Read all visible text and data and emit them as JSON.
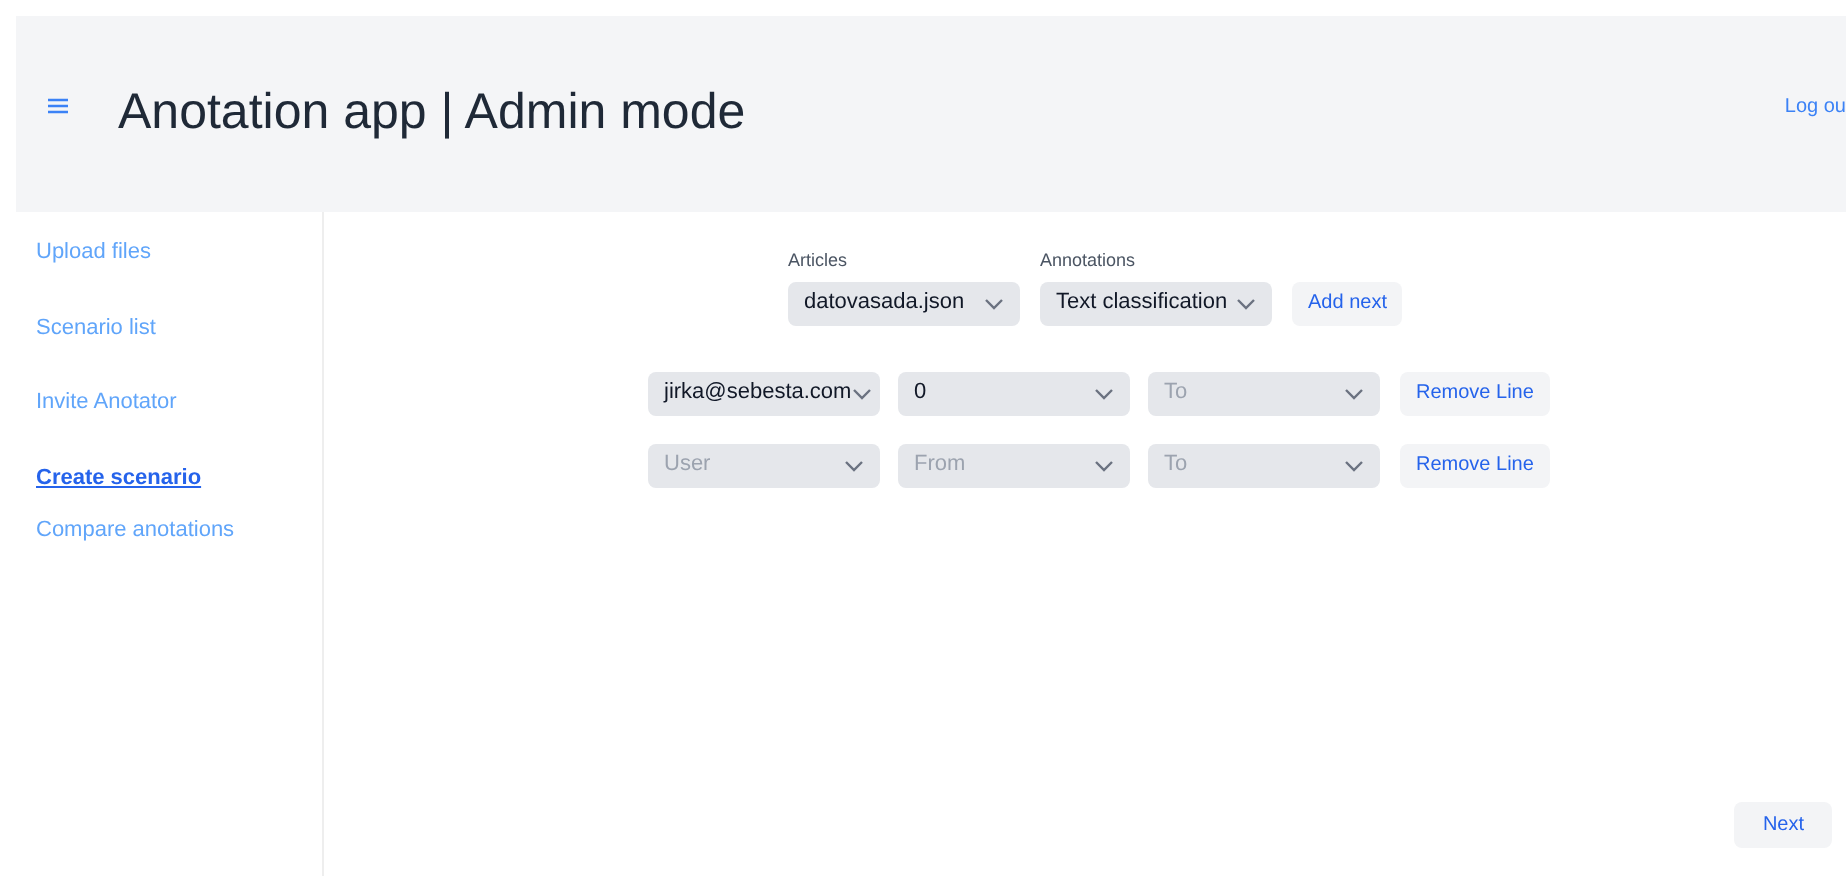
{
  "header": {
    "title": "Anotation app | Admin mode",
    "logout": "Log ou"
  },
  "sidebar": {
    "items": [
      {
        "label": "Upload files",
        "selected": false
      },
      {
        "label": "Scenario list",
        "selected": false
      },
      {
        "label": "Invite Anotator",
        "selected": false
      },
      {
        "label": "Create scenario",
        "selected": true
      },
      {
        "label": "Compare anotations",
        "selected": false
      }
    ]
  },
  "selectors": [
    {
      "label": "Articles",
      "value": "datovasada.json"
    },
    {
      "label": "Annotations",
      "value": "Text classification"
    }
  ],
  "add_button": "Add next",
  "lines": [
    {
      "fields": [
        {
          "value": "jirka@sebesta.com"
        },
        {
          "value": "0"
        },
        {
          "placeholder": "To"
        }
      ],
      "remove": "Remove Line"
    },
    {
      "fields": [
        {
          "placeholder": "User"
        },
        {
          "placeholder": "From"
        },
        {
          "placeholder": "To"
        }
      ],
      "remove": "Remove Line"
    }
  ],
  "next_button": "Next"
}
